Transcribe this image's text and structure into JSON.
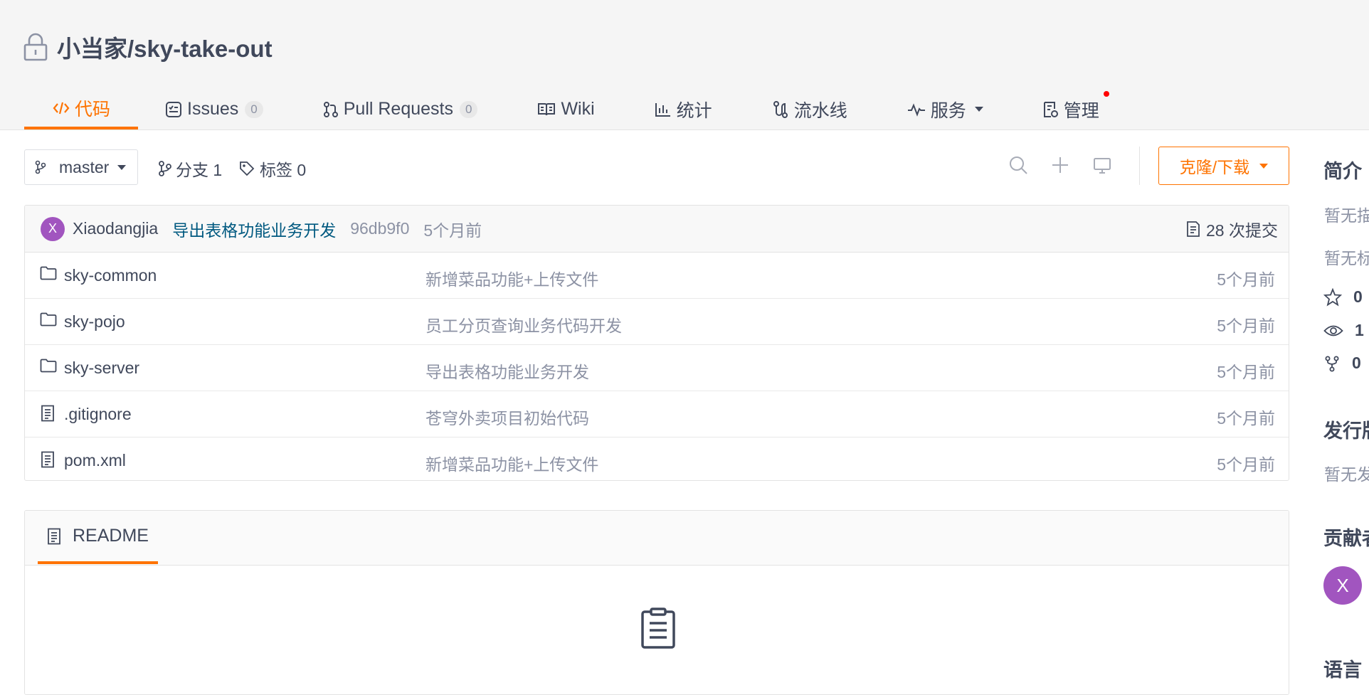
{
  "header": {
    "repo_title": "小当家/sky-take-out",
    "tabs": [
      {
        "label": "代码",
        "icon": "code-icon",
        "active": true
      },
      {
        "label": "Issues",
        "badge": "0",
        "icon": "issues-icon"
      },
      {
        "label": "Pull Requests",
        "badge": "0",
        "icon": "pull-request-icon"
      },
      {
        "label": "Wiki",
        "icon": "wiki-icon"
      },
      {
        "label": "统计",
        "icon": "stats-icon"
      },
      {
        "label": "流水线",
        "icon": "pipeline-icon"
      },
      {
        "label": "服务",
        "icon": "service-icon"
      },
      {
        "label": "管理",
        "icon": "manage-icon"
      }
    ]
  },
  "toolbar": {
    "branch": "master",
    "branches_label": "分支 1",
    "tags_label": "标签 0",
    "clone_label": "克隆/下载"
  },
  "commit": {
    "avatar_letter": "X",
    "author": "Xiaodangjia",
    "message": "导出表格功能业务开发",
    "sha": "96db9f0",
    "time": "5个月前",
    "count_label": "28 次提交"
  },
  "files": [
    {
      "name": "sky-common",
      "type": "folder",
      "message": "新增菜品功能+上传文件",
      "time": "5个月前"
    },
    {
      "name": "sky-pojo",
      "type": "folder",
      "message": "员工分页查询业务代码开发",
      "time": "5个月前"
    },
    {
      "name": "sky-server",
      "type": "folder",
      "message": "导出表格功能业务开发",
      "time": "5个月前"
    },
    {
      "name": ".gitignore",
      "type": "file",
      "message": "苍穹外卖项目初始代码",
      "time": "5个月前"
    },
    {
      "name": "pom.xml",
      "type": "file",
      "message": "新增菜品功能+上传文件",
      "time": "5个月前"
    }
  ],
  "readme": {
    "tab_label": "README"
  },
  "sidebar": {
    "intro_heading": "简介",
    "intro_desc": "暂无描",
    "intro_tags": "暂无标",
    "stars": "0",
    "watchers": "1",
    "forks": "0 ",
    "releases_heading": "发行版",
    "releases_text": "暂无发",
    "contributors_heading": "贡献者",
    "contributor_letter": "X",
    "language_heading": "语言"
  },
  "colors": {
    "accent": "#fe7300",
    "link": "#005980",
    "avatar": "#a155bf",
    "muted": "#8c92a4",
    "text": "#40485b"
  }
}
